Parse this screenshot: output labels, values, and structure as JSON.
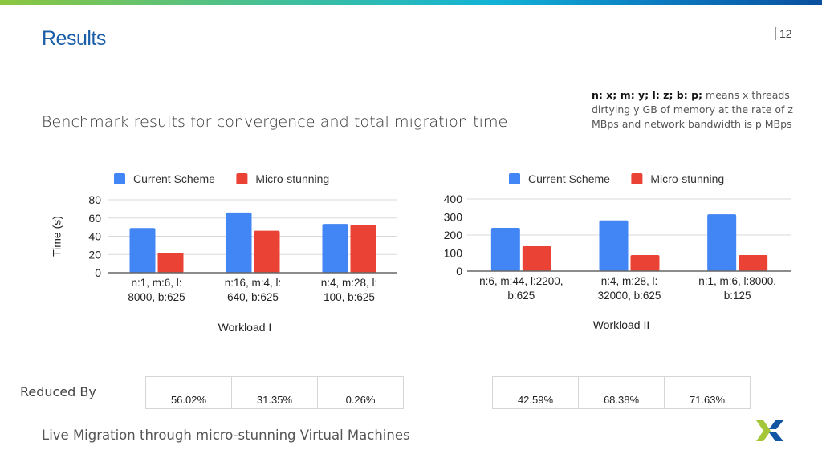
{
  "slide": {
    "title": "Results",
    "page_number": "12",
    "subtitle": "Benchmark results for convergence and total migration time",
    "note_bold": "n: x; m: y; l: z; b: p;",
    "note_rest": " means x threads dirtying y GB of memory at the rate of z MBps and network bandwidth is p MBps",
    "reduced_by_label": "Reduced By",
    "footer": "Live Migration through micro-stunning Virtual Machines",
    "logo": "x-logo-icon",
    "colors": {
      "accent": "#1a5ea8",
      "logo_green": "#a4c639",
      "logo_blue": "#1155a3"
    }
  },
  "chart_data": [
    {
      "type": "bar",
      "title": "",
      "xlabel": "Workload I",
      "ylabel": "Time (s)",
      "ylim": [
        0,
        80
      ],
      "yticks": [
        0,
        20,
        40,
        60,
        80
      ],
      "grid": true,
      "legend": "top",
      "categories": [
        [
          "n:1, m:6, l:",
          "8000, b:625"
        ],
        [
          "n:16, m:4, l:",
          "640, b:625"
        ],
        [
          "n:4, m:28, l:",
          "100, b:625"
        ]
      ],
      "series": [
        {
          "name": "Current Scheme",
          "color": "#4285f4",
          "values": [
            49,
            66,
            53.5
          ]
        },
        {
          "name": "Micro-stunning",
          "color": "#ea4335",
          "values": [
            22,
            46,
            52.5
          ]
        }
      ],
      "reduced_by": [
        "56.02%",
        "31.35%",
        "0.26%"
      ]
    },
    {
      "type": "bar",
      "title": "",
      "xlabel": "Workload II",
      "ylabel": "",
      "ylim": [
        0,
        400
      ],
      "yticks": [
        0,
        100,
        200,
        300,
        400
      ],
      "grid": true,
      "legend": "top",
      "categories": [
        [
          "n:6, m:44, l:2200,",
          "b:625"
        ],
        [
          "n:4, m:28, l:",
          "32000, b:625"
        ],
        [
          "n:1, m:6, l:8000,",
          "b:125"
        ]
      ],
      "series": [
        {
          "name": "Current Scheme",
          "color": "#4285f4",
          "values": [
            240,
            281,
            315
          ]
        },
        {
          "name": "Micro-stunning",
          "color": "#ea4335",
          "values": [
            138,
            89,
            89
          ]
        }
      ],
      "reduced_by": [
        "42.59%",
        "68.38%",
        "71.63%"
      ]
    }
  ]
}
